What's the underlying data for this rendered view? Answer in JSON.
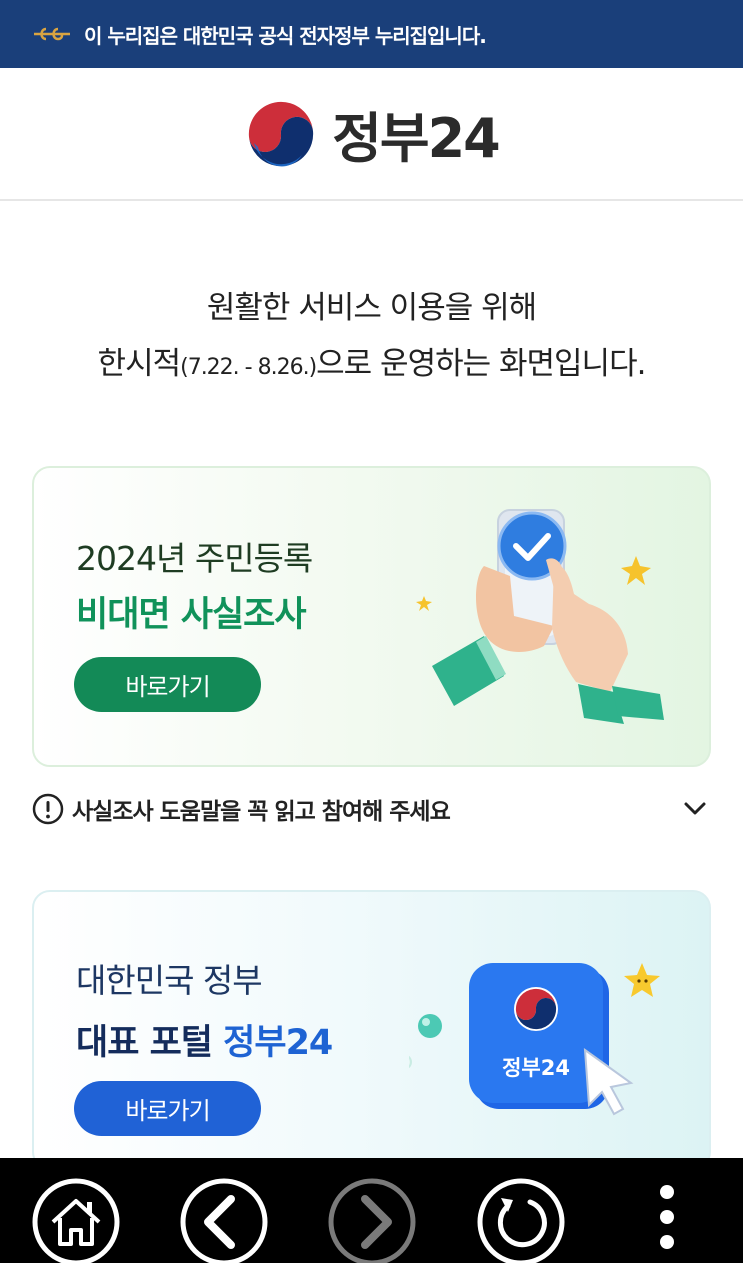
{
  "banner": {
    "text": "이 누리집은 대한민국 공식 전자정부 누리집입니다."
  },
  "header": {
    "logo_text": "정부24"
  },
  "intro": {
    "line1": "원활한 서비스 이용을 위해",
    "line2_prefix": "한시적",
    "line2_period": "(7.22. - 8.26.)",
    "line2_suffix": "으로 운영하는 화면입니다."
  },
  "survey_card": {
    "title1": "2024년 주민등록",
    "title2": "비대면 사실조사",
    "button_label": "바로가기"
  },
  "help": {
    "label": "사실조사 도움말을 꼭 읽고 참여해 주세요"
  },
  "portal_card": {
    "title1": "대한민국 정부",
    "title2_prefix": "대표 포털 ",
    "title2_accent": "정부24",
    "button_label": "바로가기",
    "app_icon_text": "정부24"
  },
  "nav": {
    "icons": [
      "home-icon",
      "back-icon",
      "forward-icon",
      "reload-icon",
      "more-icon"
    ]
  },
  "colors": {
    "banner_bg": "#1a3f7a",
    "survey_accent": "#138a57",
    "portal_accent": "#2062d6"
  }
}
